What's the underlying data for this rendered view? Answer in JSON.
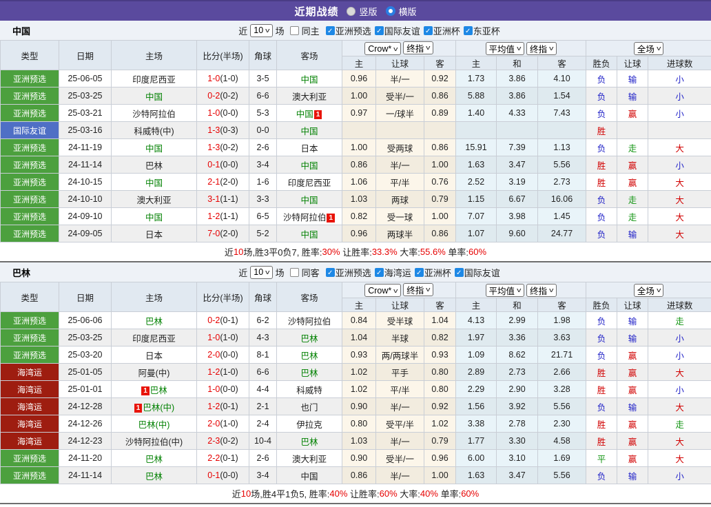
{
  "topbar": {
    "title": "近期战绩",
    "radio_vertical": "竖版",
    "radio_horizontal": "横版"
  },
  "filter_labels": {
    "near": "近",
    "games": "场"
  },
  "columns": {
    "type": "类型",
    "date": "日期",
    "home": "主场",
    "score": "比分(半场)",
    "corner": "角球",
    "away": "客场",
    "odds_home": "主",
    "odds_handicap": "让球",
    "odds_away": "客",
    "avg_home": "主",
    "avg_draw": "和",
    "avg_away": "客",
    "result_wl": "胜负",
    "result_handicap": "让球",
    "result_goals": "进球数",
    "sel_crow": "Crow*",
    "sel_final1": "终指",
    "sel_avg": "平均值",
    "sel_final2": "终指",
    "sel_full": "全场"
  },
  "colors": {
    "topbar_purple": "#5a4a9e",
    "badge_green": "#4ca03e",
    "badge_blue": "#4f6fc5",
    "badge_maroon": "#9e1d10",
    "team_green": "#008000",
    "score_red": "#e60000",
    "result_red": "#d10000",
    "result_blue": "#2324c8",
    "result_green": "#149614",
    "summary_red": "#e60000",
    "checkbox_blue": "#1e88e5"
  },
  "sections": [
    {
      "team": "中国",
      "filter": {
        "count": "10",
        "same_label": "同主",
        "same_checked": false,
        "leagues": [
          "亚洲预选",
          "国际友谊",
          "亚洲杯",
          "东亚杯"
        ]
      },
      "rows": [
        {
          "t": "亚洲预选",
          "tc": "badge_green",
          "d": "25-06-05",
          "h": "印度尼西亚",
          "hg": 0,
          "hb": "",
          "ha": "",
          "s": "1-0",
          "f": "(1-0)",
          "c": "3-5",
          "a": "中国",
          "ag": 1,
          "ab": "",
          "aa": "",
          "o1": "0.96",
          "o2": "半/一",
          "o3": "0.92",
          "v1": "1.73",
          "v2": "3.86",
          "v3": "4.10",
          "r1": "负",
          "r1c": "blue",
          "r2": "输",
          "r2c": "blue",
          "r3": "小",
          "r3c": "blue"
        },
        {
          "t": "亚洲预选",
          "tc": "badge_green",
          "d": "25-03-25",
          "h": "中国",
          "hg": 1,
          "hb": "",
          "ha": "",
          "s": "0-2",
          "f": "(0-2)",
          "c": "6-6",
          "a": "澳大利亚",
          "ag": 0,
          "ab": "",
          "aa": "",
          "o1": "1.00",
          "o2": "受半/一",
          "o3": "0.86",
          "v1": "5.88",
          "v2": "3.86",
          "v3": "1.54",
          "r1": "负",
          "r1c": "blue",
          "r2": "输",
          "r2c": "blue",
          "r3": "小",
          "r3c": "blue"
        },
        {
          "t": "亚洲预选",
          "tc": "badge_green",
          "d": "25-03-21",
          "h": "沙特阿拉伯",
          "hg": 0,
          "hb": "",
          "ha": "",
          "s": "1-0",
          "f": "(0-0)",
          "c": "5-3",
          "a": "中国",
          "ag": 1,
          "ab": "",
          "aa": "1",
          "o1": "0.97",
          "o2": "一/球半",
          "o3": "0.89",
          "v1": "1.40",
          "v2": "4.33",
          "v3": "7.43",
          "r1": "负",
          "r1c": "blue",
          "r2": "赢",
          "r2c": "red",
          "r3": "小",
          "r3c": "blue"
        },
        {
          "t": "国际友谊",
          "tc": "badge_blue",
          "d": "25-03-16",
          "h": "科威特(中)",
          "hg": 0,
          "hb": "",
          "ha": "",
          "s": "1-3",
          "f": "(0-3)",
          "c": "0-0",
          "a": "中国",
          "ag": 1,
          "ab": "",
          "aa": "",
          "o1": "",
          "o2": "",
          "o3": "",
          "v1": "",
          "v2": "",
          "v3": "",
          "r1": "胜",
          "r1c": "red",
          "r2": "",
          "r2c": "red",
          "r3": "",
          "r3c": "red"
        },
        {
          "t": "亚洲预选",
          "tc": "badge_green",
          "d": "24-11-19",
          "h": "中国",
          "hg": 1,
          "hb": "",
          "ha": "",
          "s": "1-3",
          "f": "(0-2)",
          "c": "2-6",
          "a": "日本",
          "ag": 0,
          "ab": "",
          "aa": "",
          "o1": "1.00",
          "o2": "受两球",
          "o3": "0.86",
          "v1": "15.91",
          "v2": "7.39",
          "v3": "1.13",
          "r1": "负",
          "r1c": "blue",
          "r2": "走",
          "r2c": "green",
          "r3": "大",
          "r3c": "red"
        },
        {
          "t": "亚洲预选",
          "tc": "badge_green",
          "d": "24-11-14",
          "h": "巴林",
          "hg": 0,
          "hb": "",
          "ha": "",
          "s": "0-1",
          "f": "(0-0)",
          "c": "3-4",
          "a": "中国",
          "ag": 1,
          "ab": "",
          "aa": "",
          "o1": "0.86",
          "o2": "半/一",
          "o3": "1.00",
          "v1": "1.63",
          "v2": "3.47",
          "v3": "5.56",
          "r1": "胜",
          "r1c": "red",
          "r2": "赢",
          "r2c": "red",
          "r3": "小",
          "r3c": "blue"
        },
        {
          "t": "亚洲预选",
          "tc": "badge_green",
          "d": "24-10-15",
          "h": "中国",
          "hg": 1,
          "hb": "",
          "ha": "",
          "s": "2-1",
          "f": "(2-0)",
          "c": "1-6",
          "a": "印度尼西亚",
          "ag": 0,
          "ab": "",
          "aa": "",
          "o1": "1.06",
          "o2": "平/半",
          "o3": "0.76",
          "v1": "2.52",
          "v2": "3.19",
          "v3": "2.73",
          "r1": "胜",
          "r1c": "red",
          "r2": "赢",
          "r2c": "red",
          "r3": "大",
          "r3c": "red"
        },
        {
          "t": "亚洲预选",
          "tc": "badge_green",
          "d": "24-10-10",
          "h": "澳大利亚",
          "hg": 0,
          "hb": "",
          "ha": "",
          "s": "3-1",
          "f": "(1-1)",
          "c": "3-3",
          "a": "中国",
          "ag": 1,
          "ab": "",
          "aa": "",
          "o1": "1.03",
          "o2": "两球",
          "o3": "0.79",
          "v1": "1.15",
          "v2": "6.67",
          "v3": "16.06",
          "r1": "负",
          "r1c": "blue",
          "r2": "走",
          "r2c": "green",
          "r3": "大",
          "r3c": "red"
        },
        {
          "t": "亚洲预选",
          "tc": "badge_green",
          "d": "24-09-10",
          "h": "中国",
          "hg": 1,
          "hb": "",
          "ha": "",
          "s": "1-2",
          "f": "(1-1)",
          "c": "6-5",
          "a": "沙特阿拉伯",
          "ag": 0,
          "ab": "",
          "aa": "1",
          "o1": "0.82",
          "o2": "受一球",
          "o3": "1.00",
          "v1": "7.07",
          "v2": "3.98",
          "v3": "1.45",
          "r1": "负",
          "r1c": "blue",
          "r2": "走",
          "r2c": "green",
          "r3": "大",
          "r3c": "red"
        },
        {
          "t": "亚洲预选",
          "tc": "badge_green",
          "d": "24-09-05",
          "h": "日本",
          "hg": 0,
          "hb": "",
          "ha": "",
          "s": "7-0",
          "f": "(2-0)",
          "c": "5-2",
          "a": "中国",
          "ag": 1,
          "ab": "",
          "aa": "",
          "o1": "0.96",
          "o2": "两球半",
          "o3": "0.86",
          "v1": "1.07",
          "v2": "9.60",
          "v3": "24.77",
          "r1": "负",
          "r1c": "blue",
          "r2": "输",
          "r2c": "blue",
          "r3": "大",
          "r3c": "red"
        }
      ],
      "summary": [
        {
          "t": "近"
        },
        {
          "t": "10",
          "red": true
        },
        {
          "t": "场,胜3平0负7, 胜率:"
        },
        {
          "t": "30%",
          "red": true
        },
        {
          "t": " 让胜率:"
        },
        {
          "t": "33.3%",
          "red": true
        },
        {
          "t": " 大率:"
        },
        {
          "t": "55.6%",
          "red": true
        },
        {
          "t": " 单率:"
        },
        {
          "t": "60%",
          "red": true
        }
      ]
    },
    {
      "team": "巴林",
      "filter": {
        "count": "10",
        "same_label": "同客",
        "same_checked": false,
        "leagues": [
          "亚洲预选",
          "海湾运",
          "亚洲杯",
          "国际友谊"
        ]
      },
      "rows": [
        {
          "t": "亚洲预选",
          "tc": "badge_green",
          "d": "25-06-06",
          "h": "巴林",
          "hg": 1,
          "hb": "",
          "ha": "",
          "s": "0-2",
          "f": "(0-1)",
          "c": "6-2",
          "a": "沙特阿拉伯",
          "ag": 0,
          "ab": "",
          "aa": "",
          "o1": "0.84",
          "o2": "受半球",
          "o3": "1.04",
          "v1": "4.13",
          "v2": "2.99",
          "v3": "1.98",
          "r1": "负",
          "r1c": "blue",
          "r2": "输",
          "r2c": "blue",
          "r3": "走",
          "r3c": "green"
        },
        {
          "t": "亚洲预选",
          "tc": "badge_green",
          "d": "25-03-25",
          "h": "印度尼西亚",
          "hg": 0,
          "hb": "",
          "ha": "",
          "s": "1-0",
          "f": "(1-0)",
          "c": "4-3",
          "a": "巴林",
          "ag": 1,
          "ab": "",
          "aa": "",
          "o1": "1.04",
          "o2": "半球",
          "o3": "0.82",
          "v1": "1.97",
          "v2": "3.36",
          "v3": "3.63",
          "r1": "负",
          "r1c": "blue",
          "r2": "输",
          "r2c": "blue",
          "r3": "小",
          "r3c": "blue"
        },
        {
          "t": "亚洲预选",
          "tc": "badge_green",
          "d": "25-03-20",
          "h": "日本",
          "hg": 0,
          "hb": "",
          "ha": "",
          "s": "2-0",
          "f": "(0-0)",
          "c": "8-1",
          "a": "巴林",
          "ag": 1,
          "ab": "",
          "aa": "",
          "o1": "0.93",
          "o2": "两/两球半",
          "o3": "0.93",
          "v1": "1.09",
          "v2": "8.62",
          "v3": "21.71",
          "r1": "负",
          "r1c": "blue",
          "r2": "赢",
          "r2c": "red",
          "r3": "小",
          "r3c": "blue"
        },
        {
          "t": "海湾运",
          "tc": "badge_maroon",
          "d": "25-01-05",
          "h": "阿曼(中)",
          "hg": 0,
          "hb": "",
          "ha": "",
          "s": "1-2",
          "f": "(1-0)",
          "c": "6-6",
          "a": "巴林",
          "ag": 1,
          "ab": "",
          "aa": "",
          "o1": "1.02",
          "o2": "平手",
          "o3": "0.80",
          "v1": "2.89",
          "v2": "2.73",
          "v3": "2.66",
          "r1": "胜",
          "r1c": "red",
          "r2": "赢",
          "r2c": "red",
          "r3": "大",
          "r3c": "red"
        },
        {
          "t": "海湾运",
          "tc": "badge_maroon",
          "d": "25-01-01",
          "h": "巴林",
          "hg": 1,
          "hb": "1",
          "ha": "",
          "s": "1-0",
          "f": "(0-0)",
          "c": "4-4",
          "a": "科威特",
          "ag": 0,
          "ab": "",
          "aa": "",
          "o1": "1.02",
          "o2": "平/半",
          "o3": "0.80",
          "v1": "2.29",
          "v2": "2.90",
          "v3": "3.28",
          "r1": "胜",
          "r1c": "red",
          "r2": "赢",
          "r2c": "red",
          "r3": "小",
          "r3c": "blue"
        },
        {
          "t": "海湾运",
          "tc": "badge_maroon",
          "d": "24-12-28",
          "h": "巴林(中)",
          "hg": 1,
          "hb": "1",
          "ha": "",
          "s": "1-2",
          "f": "(0-1)",
          "c": "2-1",
          "a": "也门",
          "ag": 0,
          "ab": "",
          "aa": "",
          "o1": "0.90",
          "o2": "半/一",
          "o3": "0.92",
          "v1": "1.56",
          "v2": "3.92",
          "v3": "5.56",
          "r1": "负",
          "r1c": "blue",
          "r2": "输",
          "r2c": "blue",
          "r3": "大",
          "r3c": "red"
        },
        {
          "t": "海湾运",
          "tc": "badge_maroon",
          "d": "24-12-26",
          "h": "巴林(中)",
          "hg": 1,
          "hb": "",
          "ha": "",
          "s": "2-0",
          "f": "(1-0)",
          "c": "2-4",
          "a": "伊拉克",
          "ag": 0,
          "ab": "",
          "aa": "",
          "o1": "0.80",
          "o2": "受平/半",
          "o3": "1.02",
          "v1": "3.38",
          "v2": "2.78",
          "v3": "2.30",
          "r1": "胜",
          "r1c": "red",
          "r2": "赢",
          "r2c": "red",
          "r3": "走",
          "r3c": "green"
        },
        {
          "t": "海湾运",
          "tc": "badge_maroon",
          "d": "24-12-23",
          "h": "沙特阿拉伯(中)",
          "hg": 0,
          "hb": "",
          "ha": "",
          "s": "2-3",
          "f": "(0-2)",
          "c": "10-4",
          "a": "巴林",
          "ag": 1,
          "ab": "",
          "aa": "",
          "o1": "1.03",
          "o2": "半/一",
          "o3": "0.79",
          "v1": "1.77",
          "v2": "3.30",
          "v3": "4.58",
          "r1": "胜",
          "r1c": "red",
          "r2": "赢",
          "r2c": "red",
          "r3": "大",
          "r3c": "red"
        },
        {
          "t": "亚洲预选",
          "tc": "badge_green",
          "d": "24-11-20",
          "h": "巴林",
          "hg": 1,
          "hb": "",
          "ha": "",
          "s": "2-2",
          "f": "(0-1)",
          "c": "2-6",
          "a": "澳大利亚",
          "ag": 0,
          "ab": "",
          "aa": "",
          "o1": "0.90",
          "o2": "受半/一",
          "o3": "0.96",
          "v1": "6.00",
          "v2": "3.10",
          "v3": "1.69",
          "r1": "平",
          "r1c": "green",
          "r2": "赢",
          "r2c": "red",
          "r3": "大",
          "r3c": "red"
        },
        {
          "t": "亚洲预选",
          "tc": "badge_green",
          "d": "24-11-14",
          "h": "巴林",
          "hg": 1,
          "hb": "",
          "ha": "",
          "s": "0-1",
          "f": "(0-0)",
          "c": "3-4",
          "a": "中国",
          "ag": 0,
          "ab": "",
          "aa": "",
          "o1": "0.86",
          "o2": "半/一",
          "o3": "1.00",
          "v1": "1.63",
          "v2": "3.47",
          "v3": "5.56",
          "r1": "负",
          "r1c": "blue",
          "r2": "输",
          "r2c": "blue",
          "r3": "小",
          "r3c": "blue"
        }
      ],
      "summary": [
        {
          "t": "近"
        },
        {
          "t": "10",
          "red": true
        },
        {
          "t": "场,胜4平1负5, 胜率:"
        },
        {
          "t": "40%",
          "red": true
        },
        {
          "t": " 让胜率:"
        },
        {
          "t": "60%",
          "red": true
        },
        {
          "t": " 大率:"
        },
        {
          "t": "40%",
          "red": true
        },
        {
          "t": " 单率:"
        },
        {
          "t": "60%",
          "red": true
        }
      ]
    }
  ]
}
